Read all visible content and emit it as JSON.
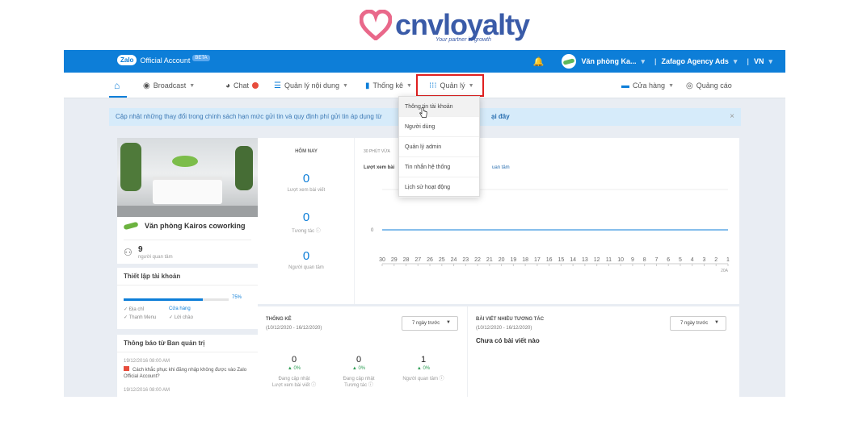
{
  "brand": {
    "name": "cnvloyalty",
    "tagline": "Your partner in growth"
  },
  "topbar": {
    "app_name": "Official Account",
    "zalo": "Zalo",
    "beta": "BETA",
    "account": "Văn phòng Ka...",
    "account_caret": "▾",
    "agency": "Zafago Agency Ads",
    "lang": "VN"
  },
  "nav": {
    "broadcast": "Broadcast",
    "chat": "Chat",
    "content": "Quản lý nội dung",
    "stats": "Thống kê",
    "manage": "Quản lý",
    "store": "Cửa hàng",
    "ads": "Quảng cáo"
  },
  "notice": {
    "text": "Cập nhật những thay đổi trong chính sách hạn mức gửi tin và quy định phí gửi tin áp dụng từ",
    "link": "ại đây",
    "close": "×"
  },
  "profile": {
    "name": "Văn phòng Kairos coworking",
    "followers": "9",
    "followers_label": "người quan tâm"
  },
  "setup": {
    "title": "Thiết lập tài khoản",
    "percent": "75%",
    "progress": 0.75,
    "items": [
      "Địa chỉ",
      "Cửa hàng",
      "Thanh Menu",
      "Lời chào"
    ]
  },
  "notif": {
    "title": "Thông báo từ Ban quản trị",
    "date1": "19/12/2016 08:00 AM",
    "msg1": "Cách khắc phục khi đăng nhập không được vào Zalo Official Account?",
    "date2": "19/12/2016 08:00 AM"
  },
  "today": {
    "heading": "HÔM NAY",
    "views": "0",
    "views_label": "Lượt xem bài viết",
    "interactions": "0",
    "interactions_label": "Tương tác ⓘ",
    "followers": "0",
    "followers_label": "Người quan tâm"
  },
  "chart": {
    "heading": "30 PHÚT VỪA",
    "tab": "Lượt xem bài",
    "link": "uan tâm"
  },
  "chart_data": {
    "type": "line",
    "x": [
      30,
      29,
      28,
      27,
      26,
      25,
      24,
      23,
      22,
      21,
      20,
      19,
      18,
      17,
      16,
      15,
      14,
      13,
      12,
      11,
      10,
      9,
      8,
      7,
      6,
      5,
      4,
      3,
      2,
      1
    ],
    "series": [
      {
        "values": [
          0,
          0,
          0,
          0,
          0,
          0,
          0,
          0,
          0,
          0,
          0,
          0,
          0,
          0,
          0,
          0,
          0,
          0,
          0,
          0,
          0,
          0,
          0,
          0,
          0,
          0,
          0,
          0,
          0,
          0
        ]
      }
    ],
    "ylabel_ticks": [
      "0"
    ],
    "xunit": "20A",
    "xlabel": "",
    "ylabel": ""
  },
  "weekly": {
    "title": "THỐNG KÊ",
    "range": "(10/12/2020 - 16/12/2020)",
    "select": "7 ngày trước",
    "kpis": [
      {
        "value": "0",
        "change": "▲ 0%",
        "label1": "Đang cập nhật",
        "label2": "Lượt xem bài viết ⓘ"
      },
      {
        "value": "0",
        "change": "▲ 0%",
        "label1": "Đang cập nhật",
        "label2": "Tương tác ⓘ"
      },
      {
        "value": "1",
        "change": "▲ 0%",
        "label1": "Người quan tâm ⓘ",
        "label2": ""
      }
    ]
  },
  "posts": {
    "title": "BÀI VIẾT NHIỀU TƯƠNG TÁC",
    "range": "(10/12/2020 - 16/12/2020)",
    "select": "7 ngày trước",
    "empty": "Chưa có bài viết nào"
  },
  "menu": {
    "items": [
      "Thông tin tài khoản",
      "Người dùng",
      "Quản lý admin",
      "Tin nhắn hệ thống",
      "Lịch sử hoạt động"
    ]
  },
  "colors": {
    "primary": "#0d7ed8",
    "highlight": "#e02020",
    "brand": "#3a5ba8",
    "heart": "#e9688a"
  }
}
